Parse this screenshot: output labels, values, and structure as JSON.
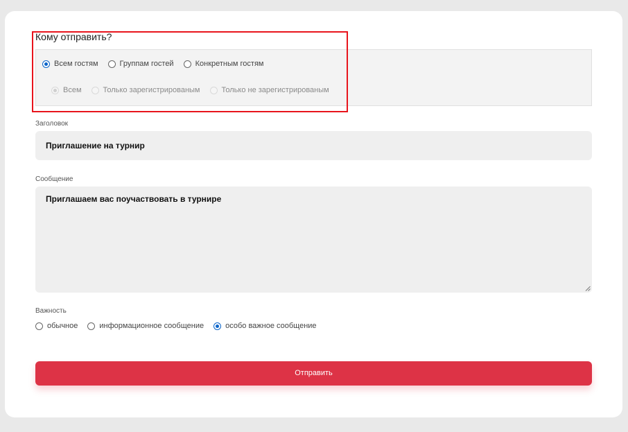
{
  "recipients": {
    "title": "Кому отправить?",
    "main_options": [
      {
        "label": "Всем гостям",
        "checked": true
      },
      {
        "label": "Группам гостей",
        "checked": false
      },
      {
        "label": "Конкретным гостям",
        "checked": false
      }
    ],
    "sub_options": [
      {
        "label": "Всем",
        "checked": true,
        "disabled": true
      },
      {
        "label": "Только зарегистрированым",
        "checked": false,
        "disabled": true
      },
      {
        "label": "Только не зарегистрированым",
        "checked": false,
        "disabled": true
      }
    ]
  },
  "title_field": {
    "label": "Заголовок",
    "value": "Приглашение на турнир"
  },
  "message_field": {
    "label": "Сообщение",
    "value": "Приглашаем вас поучаствовать в турнире"
  },
  "importance": {
    "label": "Важность",
    "options": [
      {
        "label": "обычное",
        "checked": false
      },
      {
        "label": "информационное сообщение",
        "checked": false
      },
      {
        "label": "особо важное сообщение",
        "checked": true
      }
    ]
  },
  "send_button": {
    "label": "Отправить"
  },
  "colors": {
    "accent": "#0a64c9",
    "button": "#dd3346",
    "highlight": "#e8141c"
  }
}
